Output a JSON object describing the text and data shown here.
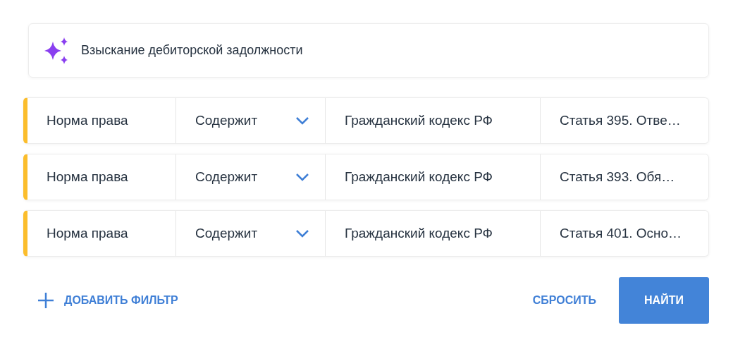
{
  "query": {
    "text": "Взыскание дебиторской задолжности"
  },
  "filters": [
    {
      "field": "Норма права",
      "operator": "Содержит",
      "source": "Гражданский кодекс РФ",
      "value": "Статья 395. Отве…"
    },
    {
      "field": "Норма права",
      "operator": "Содержит",
      "source": "Гражданский кодекс РФ",
      "value": "Статья 393. Обя…"
    },
    {
      "field": "Норма права",
      "operator": "Содержит",
      "source": "Гражданский кодекс РФ",
      "value": "Статья 401. Осно…"
    }
  ],
  "add_filter": "ДОБАВИТЬ ФИЛЬТР",
  "reset": "СБРОСИТЬ",
  "search": "НАЙТИ"
}
